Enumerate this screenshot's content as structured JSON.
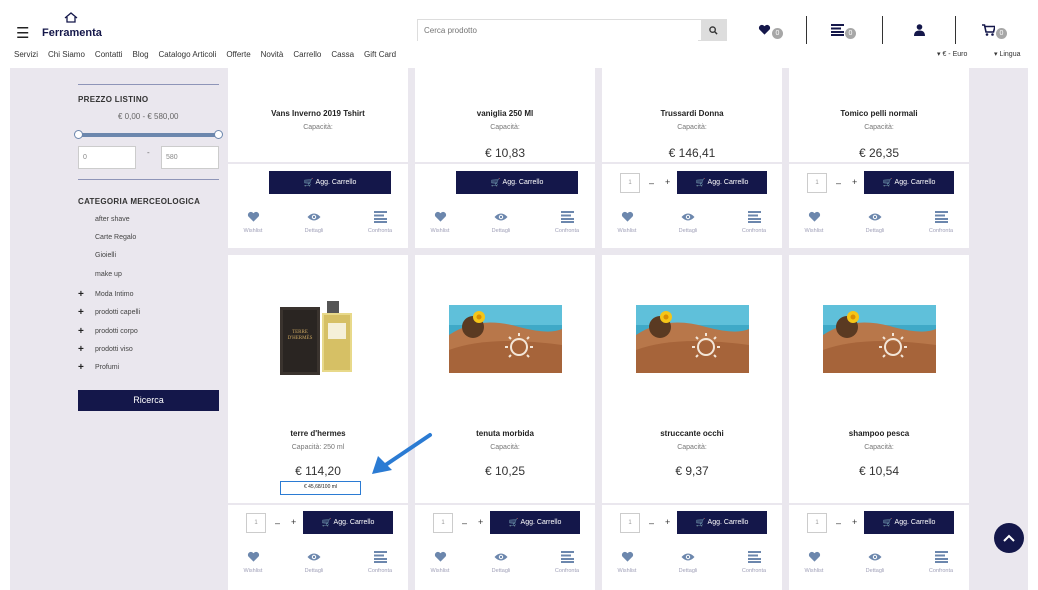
{
  "header": {
    "brand": "Ferramenta",
    "brand_sub": "",
    "search_placeholder": "Cerca prodotto",
    "wishlist_count": "0",
    "compare_count": "0",
    "cart_count": "0",
    "nav": [
      "Servizi",
      "Chi Siamo",
      "Contatti",
      "Blog",
      "Catalogo Articoli",
      "Offerte",
      "Novità",
      "Carrello",
      "Cassa",
      "Gift Card"
    ],
    "currency": "€ - Euro",
    "language": "Lingua"
  },
  "sidebar": {
    "price_heading": "PREZZO LISTINO",
    "price_range": "€ 0,00 - € 580,00",
    "price_min": "0",
    "price_max": "580",
    "price_dash": "-",
    "category_heading": "CATEGORIA MERCEOLOGICA",
    "categories": [
      {
        "label": "after shave",
        "expandable": false
      },
      {
        "label": "Carte Regalo",
        "expandable": false
      },
      {
        "label": "Gioielli",
        "expandable": false
      },
      {
        "label": "make up",
        "expandable": false
      },
      {
        "label": "Moda Intimo",
        "expandable": true
      },
      {
        "label": "prodotti capelli",
        "expandable": true
      },
      {
        "label": "prodotti corpo",
        "expandable": true
      },
      {
        "label": "prodotti viso",
        "expandable": true
      },
      {
        "label": "Profumi",
        "expandable": true
      }
    ],
    "search_button": "Ricerca"
  },
  "card_labels": {
    "add_to_cart": "Agg. Carrello",
    "wishlist": "Wishlist",
    "details": "Dettagli",
    "compare": "Confronta",
    "qty_default": "1",
    "minus": "–",
    "plus": "+"
  },
  "products_row1": [
    {
      "name": "Vans Inverno 2019 Tshirt",
      "capacity": "Capacità:",
      "price": ""
    },
    {
      "name": "vaniglia 250 Ml",
      "capacity": "Capacità:",
      "price": "€ 10,83"
    },
    {
      "name": "Trussardi Donna",
      "capacity": "Capacità:",
      "price": "€ 146,41"
    },
    {
      "name": "Tomico pelli normali",
      "capacity": "Capacità:",
      "price": "€ 26,35"
    }
  ],
  "products_row2": [
    {
      "name": "terre d'hermes",
      "capacity": "Capacità: 250 ml",
      "price": "€ 114,20",
      "unit_price": "€ 45,68/100 ml",
      "image": "perfume-bottle"
    },
    {
      "name": "tenuta morbida",
      "capacity": "Capacità:",
      "price": "€ 10,25",
      "image": "sun-tanned-back"
    },
    {
      "name": "struccante occhi",
      "capacity": "Capacità:",
      "price": "€ 9,37",
      "image": "sun-tanned-back"
    },
    {
      "name": "shampoo pesca",
      "capacity": "Capacità:",
      "price": "€ 10,54",
      "image": "sun-tanned-back"
    }
  ],
  "colors": {
    "navy": "#14174a",
    "accent_blue": "#2b7bd3",
    "icon_blue": "#6c87ad",
    "background": "#eae7ee"
  }
}
